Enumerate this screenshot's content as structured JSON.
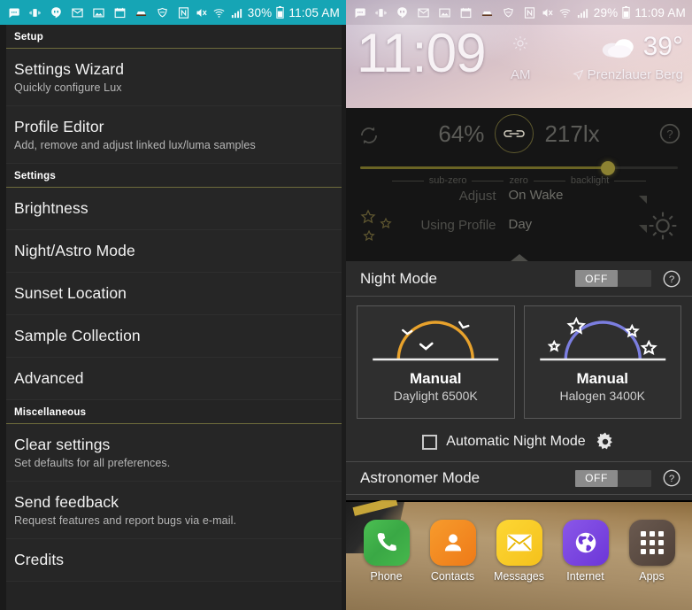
{
  "left": {
    "statusbar": {
      "icons": [
        "messages-icon",
        "vibrate-icon",
        "hangouts-icon",
        "gmail-icon",
        "photos-icon",
        "calendar-icon",
        "car-icon",
        "vpn-shield-icon",
        "nfc-icon",
        "mute-icon",
        "wifi-icon",
        "signal-icon"
      ],
      "battery_percent": "30%",
      "time": "11:05 AM"
    },
    "sections": [
      {
        "header": "Setup",
        "items": [
          {
            "title": "Settings Wizard",
            "subtitle": "Quickly configure Lux"
          },
          {
            "title": "Profile Editor",
            "subtitle": "Add, remove and adjust linked lux/luma samples"
          }
        ]
      },
      {
        "header": "Settings",
        "items": [
          {
            "title": "Brightness",
            "subtitle": ""
          },
          {
            "title": "Night/Astro Mode",
            "subtitle": ""
          },
          {
            "title": "Sunset Location",
            "subtitle": ""
          },
          {
            "title": "Sample Collection",
            "subtitle": ""
          },
          {
            "title": "Advanced",
            "subtitle": ""
          }
        ]
      },
      {
        "header": "Miscellaneous",
        "items": [
          {
            "title": "Clear settings",
            "subtitle": "Set defaults for all preferences."
          },
          {
            "title": "Send feedback",
            "subtitle": "Request features and report bugs via e-mail."
          },
          {
            "title": "Credits",
            "subtitle": ""
          }
        ]
      }
    ]
  },
  "right": {
    "statusbar": {
      "battery_percent": "29%",
      "time": "11:09 AM"
    },
    "clock_widget": {
      "time": "11:09",
      "ampm": "AM",
      "sun_icon": "sun-icon",
      "weather_icon": "cloud-icon",
      "temperature": "39°",
      "location": "Prenzlauer Berg",
      "location_icon": "location-pin-icon"
    },
    "lux_overlay": {
      "refresh_icon": "refresh-icon",
      "help_icon": "help-circle-icon",
      "brightness_percent": "64%",
      "link_icon": "chain-link-icon",
      "lux_value": "217lx",
      "slider_position_percent": 78,
      "slider_labels": [
        "sub-zero",
        "zero",
        "backlight"
      ],
      "adjust_label": "Adjust",
      "adjust_value": "On Wake",
      "profile_label": "Using Profile",
      "profile_value": "Day",
      "stars_icon": "stars-icon",
      "gear_icon": "gear-icon",
      "collapse_icon": "collapse-triangle-icon"
    },
    "night_mode": {
      "title": "Night Mode",
      "toggle_state": "OFF",
      "help_icon": "help-circle-icon",
      "cards": [
        {
          "mode": "Manual",
          "preset": "Daylight 6500K",
          "arc_color": "#e8a22c",
          "graphic": "sun-arc-birds-icon"
        },
        {
          "mode": "Manual",
          "preset": "Halogen 3400K",
          "arc_color": "#7b7ee0",
          "graphic": "moon-arc-stars-icon"
        }
      ],
      "auto_checkbox_label": "Automatic Night Mode",
      "auto_checkbox_checked": false,
      "auto_gear_icon": "gear-icon"
    },
    "astronomer_mode": {
      "title": "Astronomer Mode",
      "toggle_state": "OFF",
      "help_icon": "help-circle-icon"
    },
    "dock": {
      "items": [
        {
          "label": "Phone",
          "icon": "phone-icon"
        },
        {
          "label": "Contacts",
          "icon": "contact-person-icon"
        },
        {
          "label": "Messages",
          "icon": "envelope-icon"
        },
        {
          "label": "Internet",
          "icon": "globe-icon"
        },
        {
          "label": "Apps",
          "icon": "apps-grid-icon"
        }
      ]
    }
  },
  "colors": {
    "status_bar_teal": "#16a5b5",
    "divider_olive": "#6e6c3c",
    "daylight_arc": "#e8a22c",
    "halogen_arc": "#7b7ee0",
    "slider_fill": "#6a6424"
  }
}
